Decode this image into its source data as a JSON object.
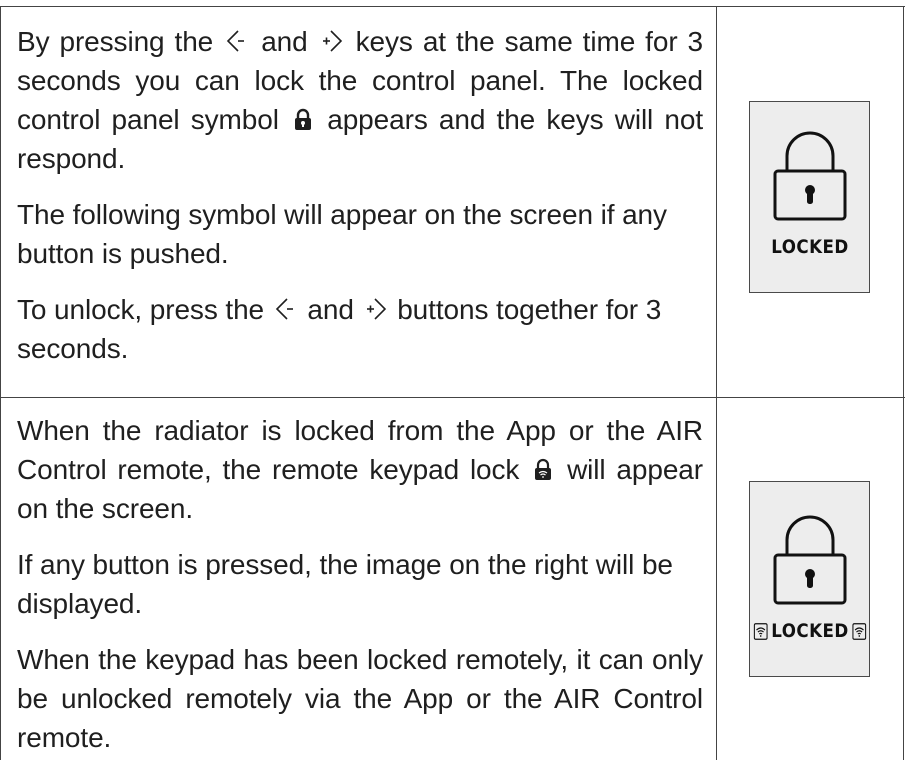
{
  "section_lock": {
    "p1": {
      "t1": "By pressing the",
      "t2": "and",
      "t3": "keys at the same time for 3 seconds you can lock the control panel. The locked control panel symbol",
      "t4": "appears and the keys will not respond."
    },
    "p2": "The following symbol will appear on the screen if any button is pushed.",
    "p3": {
      "t1": "To unlock, press the",
      "t2": "and",
      "t3": "buttons together for 3 seconds."
    },
    "panel_label": "LOCKED"
  },
  "section_remote": {
    "p1": {
      "t1": "When the radiator is locked from the App or the AIR Control remote, the remote keypad lock",
      "t2": "will appear on the screen."
    },
    "p2": "If any button is pressed, the image on the right will be displayed.",
    "p3": "When the keypad has been locked remotely, it can only be unlocked remotely via the App or the AIR Control remote.",
    "panel_label": "LOCKED"
  },
  "icons": {
    "minus_key": "minus-key-icon",
    "plus_key": "plus-key-icon",
    "lock": "lock-icon",
    "remote_lock": "remote-lock-icon",
    "wifi": "wifi-icon"
  },
  "colors": {
    "text": "#1f1f1f",
    "border": "#444444",
    "panel_bg": "#ededed"
  }
}
